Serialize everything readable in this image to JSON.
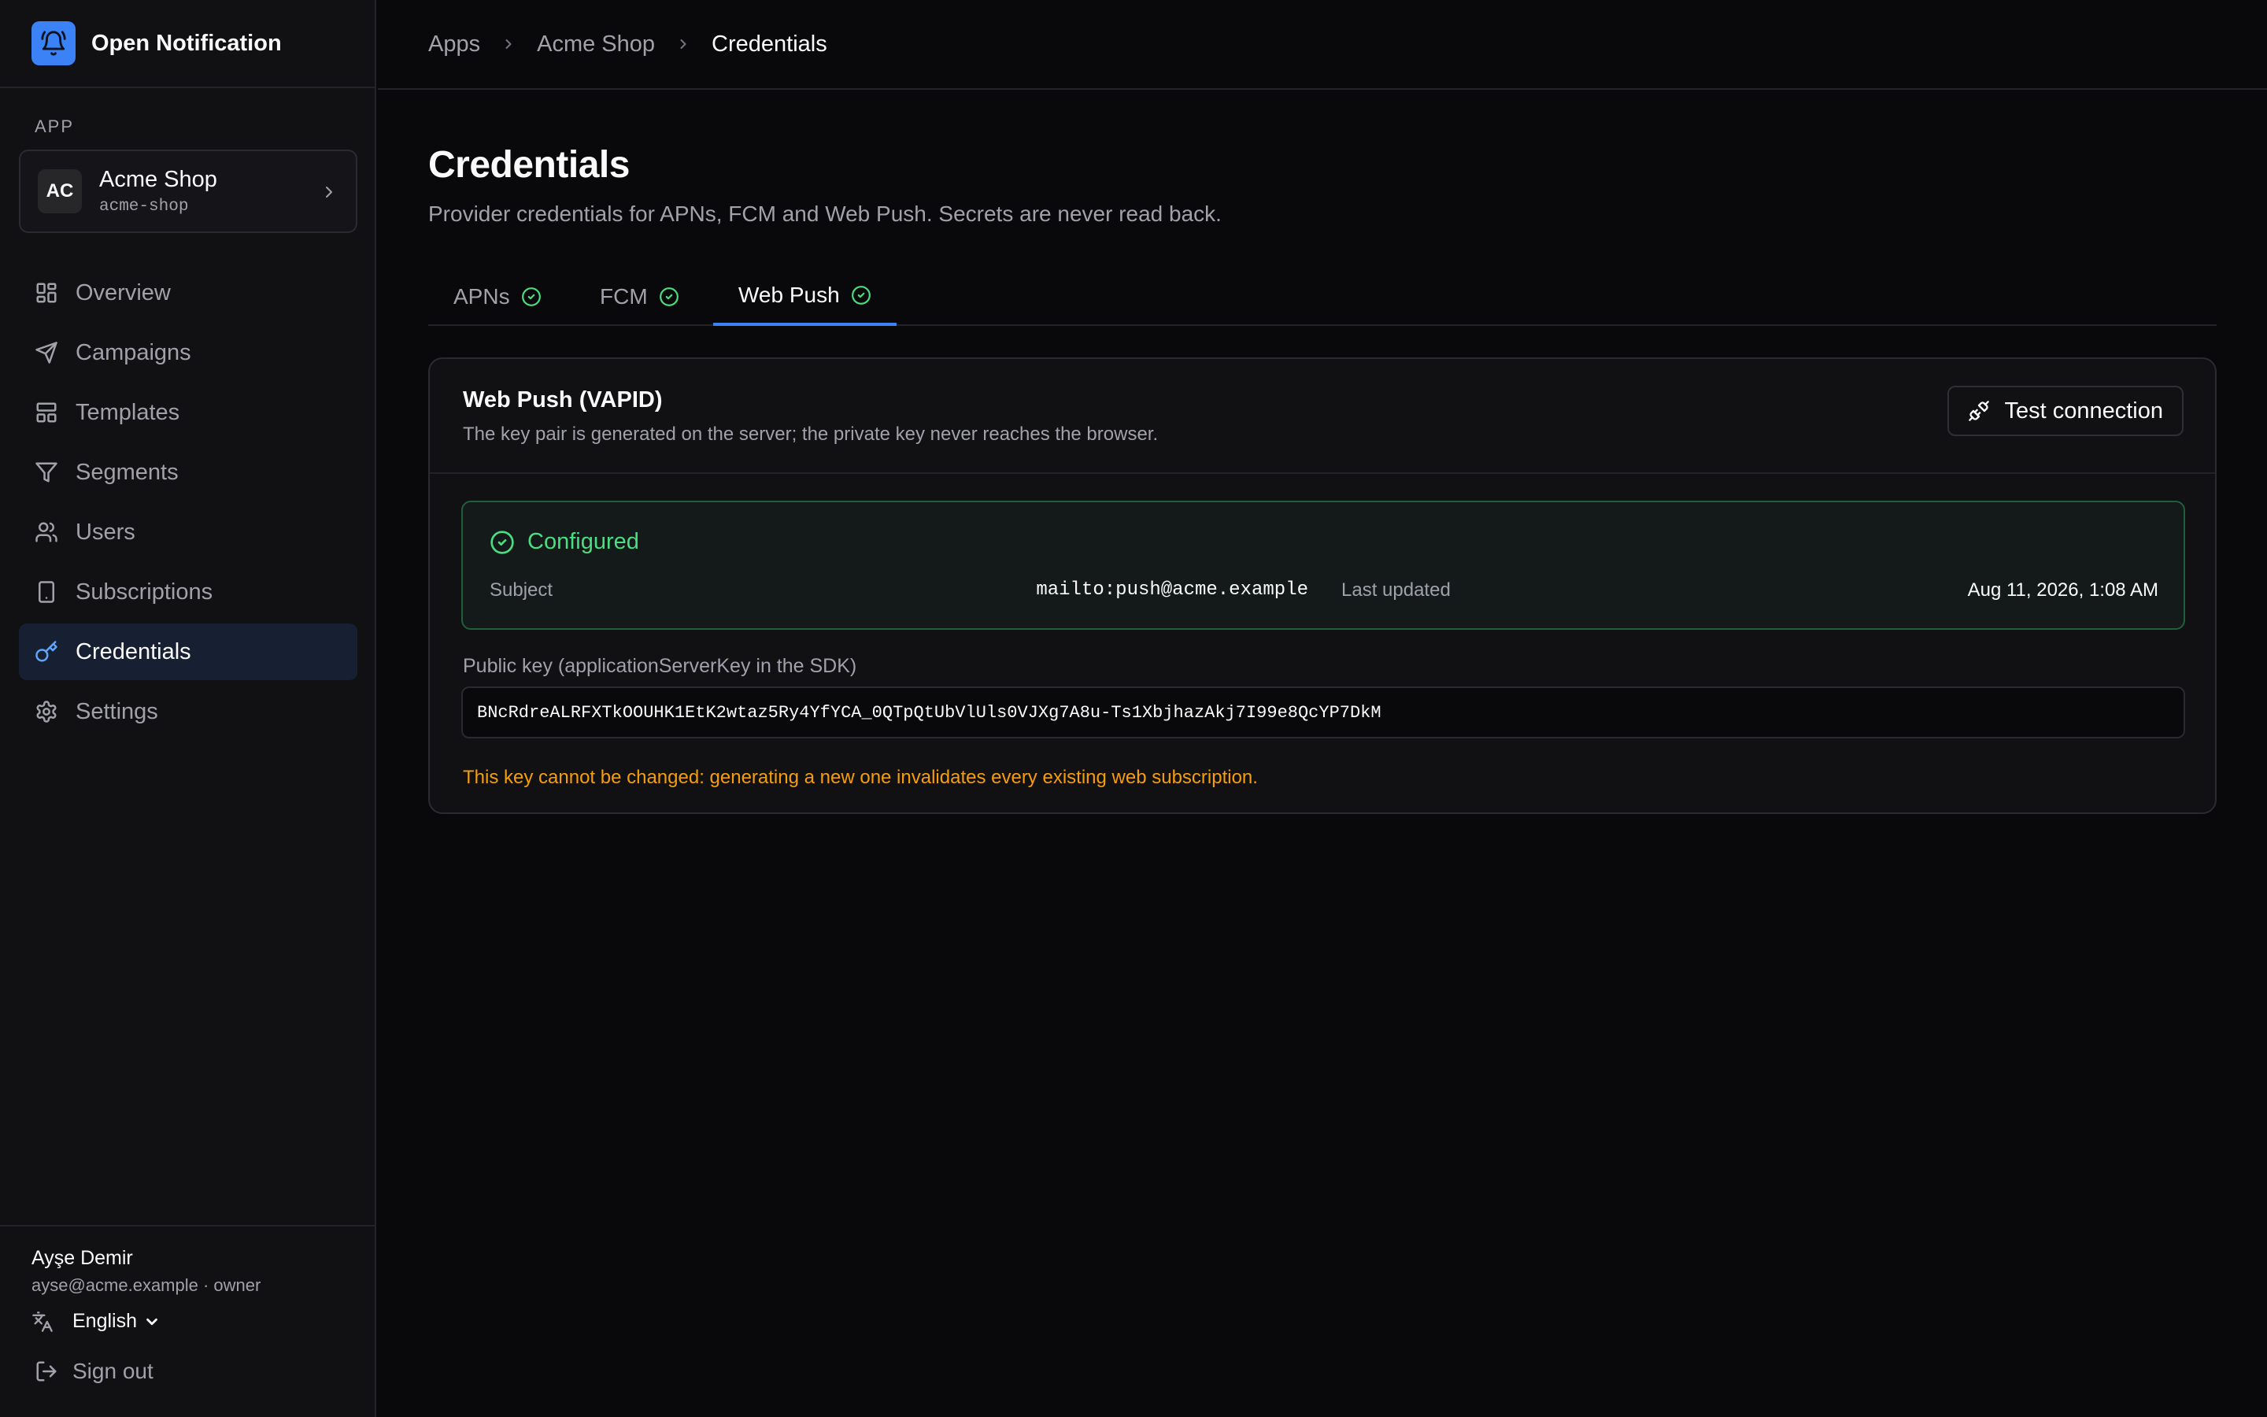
{
  "brand": {
    "name": "Open Notification",
    "icon": "bell-icon",
    "accent": "#3b82f6"
  },
  "sidebar": {
    "section_label": "APP",
    "app": {
      "initials": "AC",
      "name": "Acme Shop",
      "slug": "acme-shop"
    },
    "nav": [
      {
        "label": "Overview",
        "icon": "grid-icon",
        "active": false
      },
      {
        "label": "Campaigns",
        "icon": "send-icon",
        "active": false
      },
      {
        "label": "Templates",
        "icon": "layout-icon",
        "active": false
      },
      {
        "label": "Segments",
        "icon": "filter-icon",
        "active": false
      },
      {
        "label": "Users",
        "icon": "users-icon",
        "active": false
      },
      {
        "label": "Subscriptions",
        "icon": "smartphone-icon",
        "active": false
      },
      {
        "label": "Credentials",
        "icon": "key-icon",
        "active": true
      },
      {
        "label": "Settings",
        "icon": "gear-icon",
        "active": false
      }
    ],
    "footer": {
      "user_name": "Ayşe Demir",
      "user_meta": "ayse@acme.example · owner",
      "language": "English",
      "sign_out": "Sign out"
    }
  },
  "breadcrumb": [
    "Apps",
    "Acme Shop",
    "Credentials"
  ],
  "page": {
    "title": "Credentials",
    "description": "Provider credentials for APNs, FCM and Web Push. Secrets are never read back."
  },
  "tabs": [
    {
      "label": "APNs",
      "status": "configured"
    },
    {
      "label": "FCM",
      "status": "configured"
    },
    {
      "label": "Web Push",
      "status": "configured",
      "active": true
    }
  ],
  "card": {
    "title": "Web Push (VAPID)",
    "description": "The key pair is generated on the server; the private key never reaches the browser.",
    "test_button": "Test connection",
    "status": {
      "label": "Configured",
      "color": "#4ade80",
      "subject_label": "Subject",
      "subject_value": "mailto:push@acme.example",
      "updated_label": "Last updated",
      "updated_value": "Aug 11, 2026, 1:08 AM"
    },
    "public_key_label": "Public key (applicationServerKey in the SDK)",
    "public_key_value": "BNcRdreALRFXTkOOUHK1EtK2wtaz5Ry4YfYCA_0QTpQtUbVlUls0VJXg7A8u-Ts1XbjhazAkj7I99e8QcYP7DkM",
    "warning": "This key cannot be changed: generating a new one invalidates every existing web subscription.",
    "warning_color": "#f59e0b"
  }
}
